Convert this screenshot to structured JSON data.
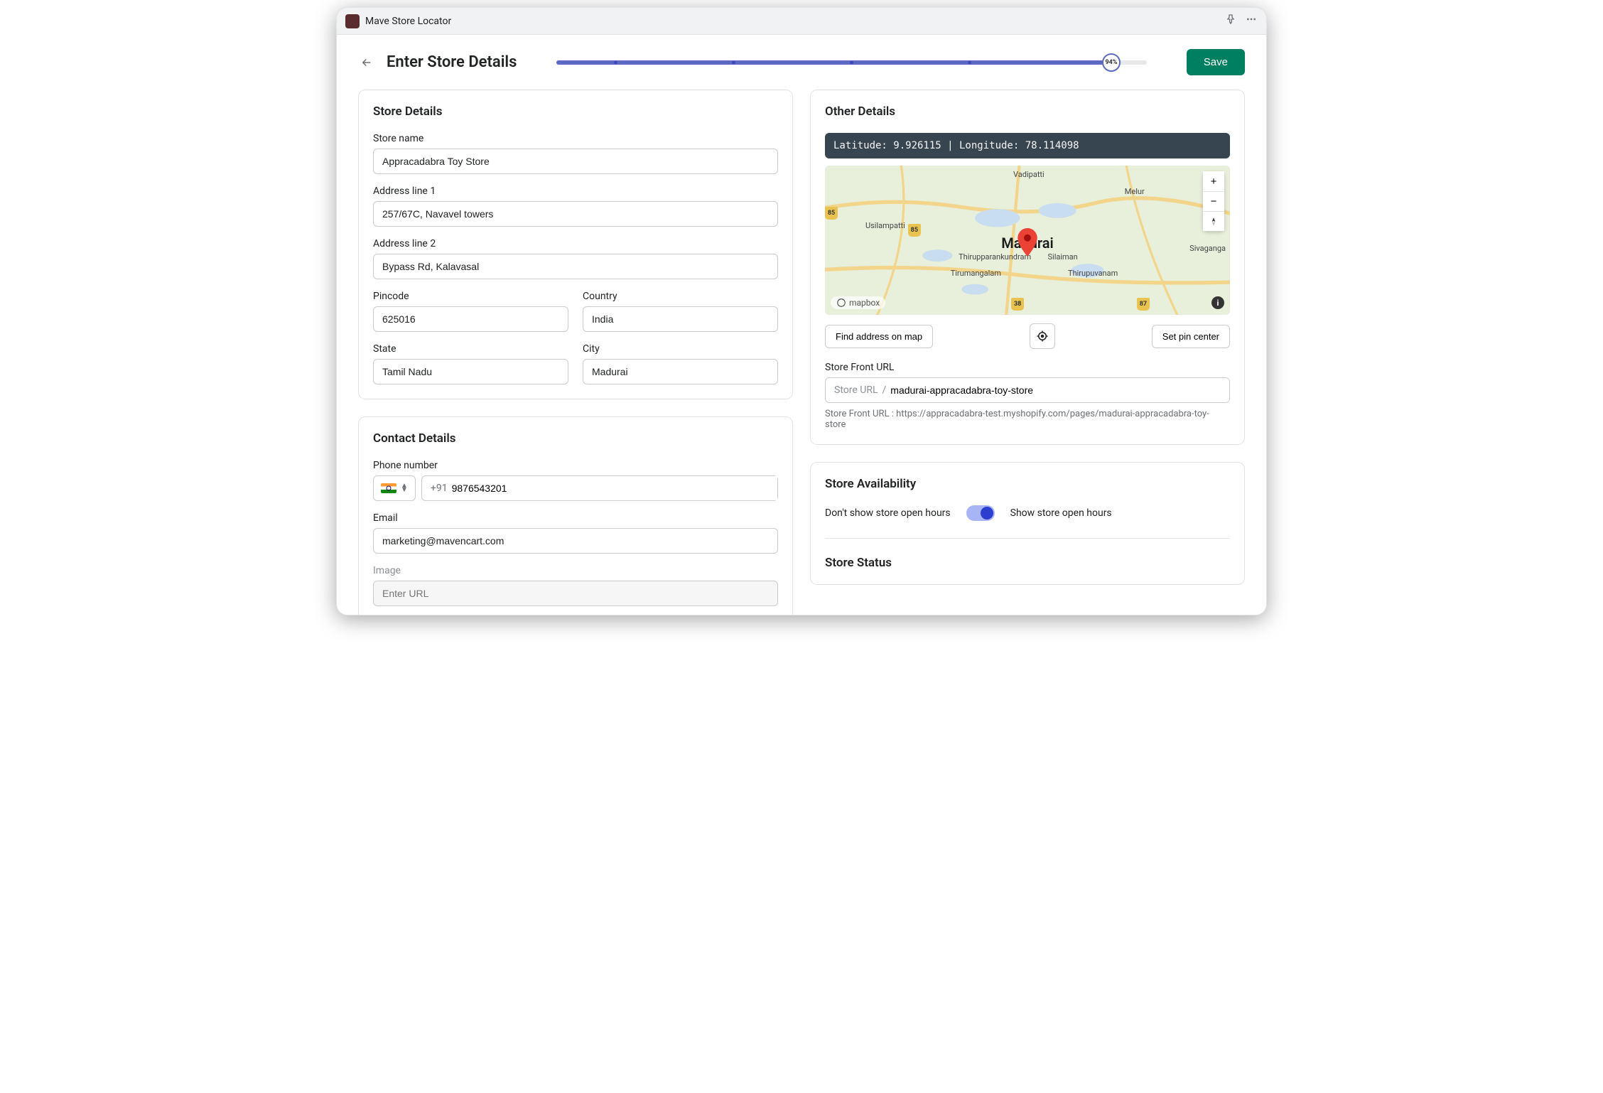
{
  "titlebar": {
    "title": "Mave Store Locator"
  },
  "header": {
    "page_title": "Enter Store Details",
    "progress_percent": "94%",
    "progress_value": 94,
    "save_label": "Save"
  },
  "store_details": {
    "heading": "Store Details",
    "store_name": {
      "label": "Store name",
      "value": "Appracadabra Toy Store"
    },
    "address1": {
      "label": "Address line 1",
      "value": "257/67C, Navavel towers"
    },
    "address2": {
      "label": "Address line 2",
      "value": "Bypass Rd, Kalavasal"
    },
    "pincode": {
      "label": "Pincode",
      "value": "625016"
    },
    "country": {
      "label": "Country",
      "value": "India"
    },
    "state": {
      "label": "State",
      "value": "Tamil Nadu"
    },
    "city": {
      "label": "City",
      "value": "Madurai"
    }
  },
  "contact_details": {
    "heading": "Contact Details",
    "phone": {
      "label": "Phone number",
      "prefix": "+91",
      "value": "9876543201"
    },
    "email": {
      "label": "Email",
      "value": "marketing@mavencart.com"
    },
    "image": {
      "label": "Image",
      "placeholder": "Enter URL"
    }
  },
  "other_details": {
    "heading": "Other Details",
    "latlon": "Latitude: 9.926115 | Longitude: 78.114098",
    "map": {
      "city_label": "Madurai",
      "labels": {
        "vadipatti": "Vadipatti",
        "melur": "Melur",
        "usilampatti": "Usilampatti",
        "thiruparankundram": "Thirupparankundram",
        "silaiman": "Silaiman",
        "tirumangalam": "Tirumangalam",
        "thirupuvanam": "Thirupuvanam",
        "sivaganga": "Sivaganga"
      },
      "shields": {
        "s1": "85",
        "s2": "85",
        "s3": "38",
        "s4": "87"
      },
      "mapbox": "mapbox"
    },
    "find_address_label": "Find address on map",
    "set_pin_label": "Set pin center",
    "store_front": {
      "label": "Store Front URL",
      "prefix": "Store URL",
      "value": "madurai-appracadabra-toy-store",
      "help": "Store Front URL : https://appracadabra-test.myshopify.com/pages/madurai-appracadabra-toy-store"
    }
  },
  "availability": {
    "heading": "Store Availability",
    "off_label": "Don't show store open hours",
    "on_label": "Show store open hours"
  },
  "status": {
    "heading": "Store Status"
  }
}
